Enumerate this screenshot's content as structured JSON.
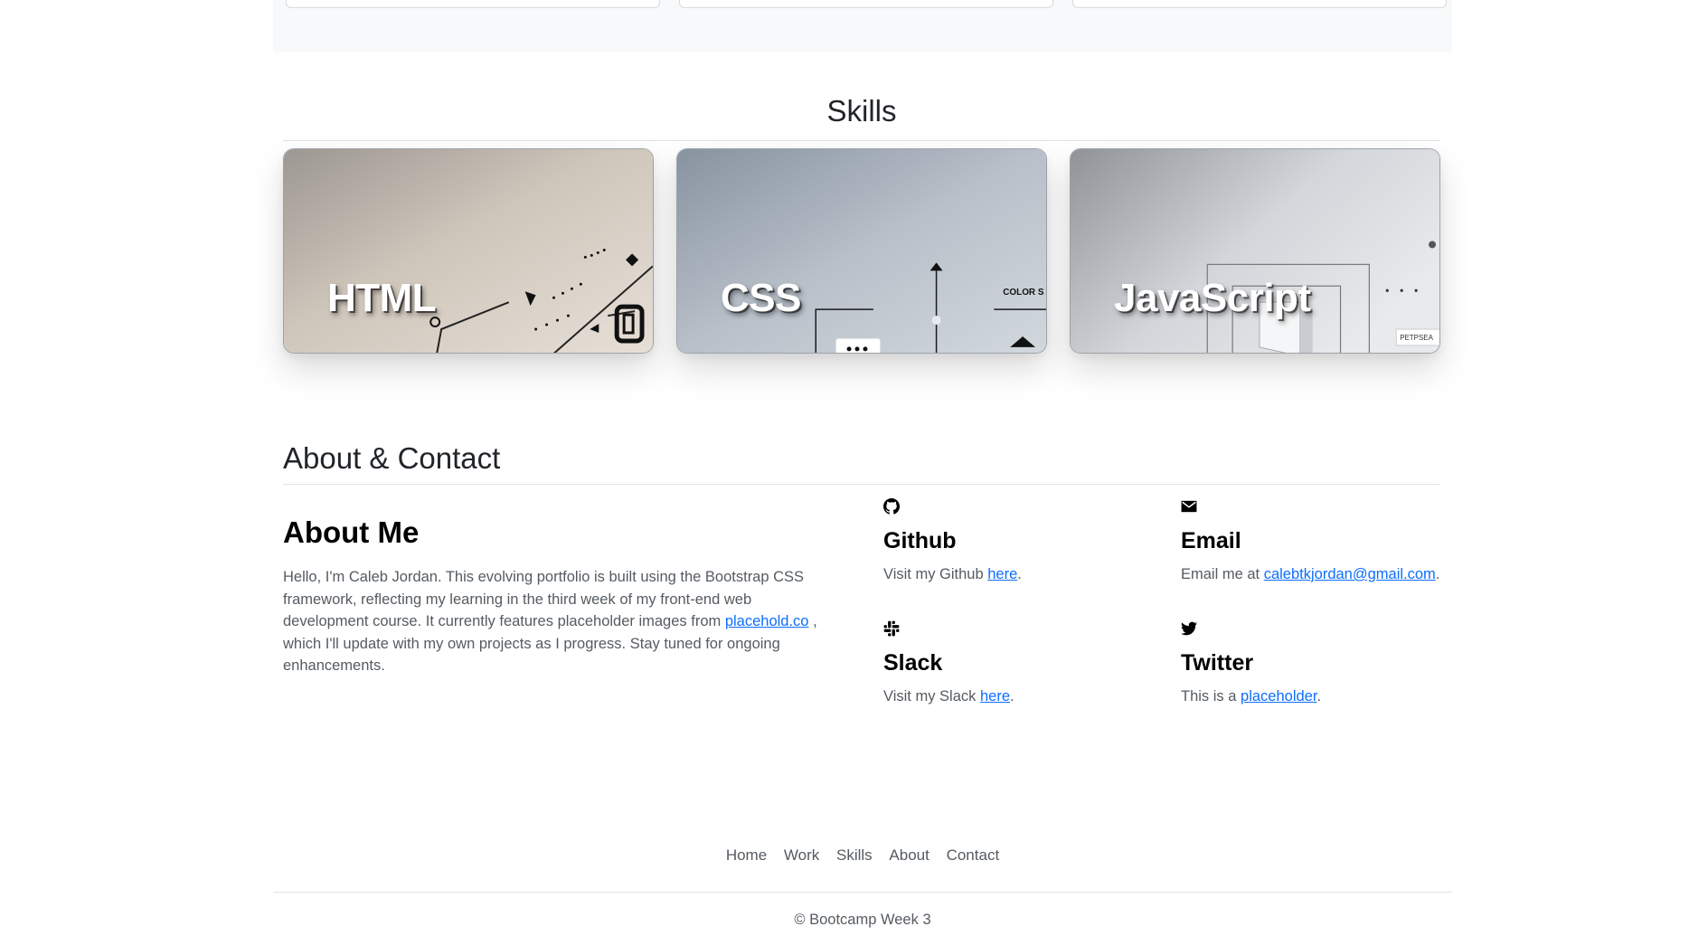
{
  "skills": {
    "title": "Skills",
    "cards": [
      {
        "label": "HTML"
      },
      {
        "label": "CSS",
        "decor_text": "COLOR S"
      },
      {
        "label": "JavaScript",
        "decor_text": "PETPSEA"
      }
    ]
  },
  "about_contact": {
    "title": "About & Contact",
    "about": {
      "heading": "About Me",
      "text_before": "Hello, I'm Caleb Jordan. This evolving portfolio is built using the Bootstrap CSS framework, reflecting my learning in the third week of my front-end web development course. It currently features placeholder images from ",
      "link": "placehold.co",
      "text_after": " , which I'll update with my own projects as I progress. Stay tuned for ongoing enhancements."
    },
    "contacts": {
      "github": {
        "icon": "github-icon",
        "title": "Github",
        "before": "Visit my Github ",
        "link": "here",
        "after": "."
      },
      "email": {
        "icon": "envelope-icon",
        "title": "Email",
        "before": "Email me at ",
        "link": "calebtkjordan@gmail.com",
        "after": "."
      },
      "slack": {
        "icon": "slack-icon",
        "title": "Slack",
        "before": "Visit my Slack ",
        "link": "here",
        "after": "."
      },
      "twitter": {
        "icon": "twitter-icon",
        "title": "Twitter",
        "before": "This is a ",
        "link": "placeholder",
        "after": "."
      }
    }
  },
  "footer": {
    "nav": [
      "Home",
      "Work",
      "Skills",
      "About",
      "Contact"
    ],
    "copyright": "© Bootcamp Week 3"
  },
  "colors": {
    "link": "#0d6efd",
    "text": "#212529",
    "muted": "#555b61",
    "strip": "#f8f9fa"
  }
}
